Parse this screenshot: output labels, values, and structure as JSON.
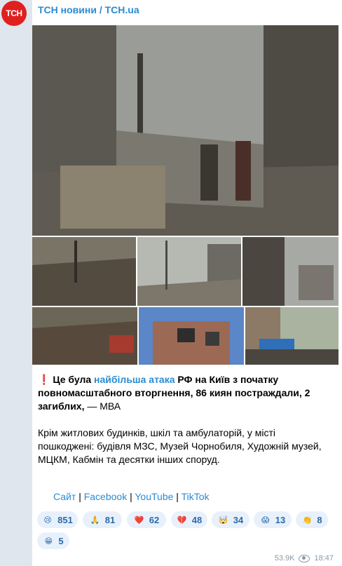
{
  "channel": {
    "avatar_text": "TCH",
    "title": "ТСН новини / TCH.ua"
  },
  "message": {
    "lead_excl": "❗",
    "lead_part1": "Це була ",
    "lead_link": "найбільша атака",
    "lead_part2": " РФ на Київ з початку повномасштабного вторгнення, 86 киян постраждали, 2 загиблих,",
    "lead_source": " — МВА",
    "paragraph2": "Крім житлових будинків, шкіл та амбулаторій, у місті пошкоджені: будівля МЗС, Музей Чорнобиля, Художній музей, МЦКМ, Кабмін та десятки інших споруд."
  },
  "links": {
    "site": "Сайт",
    "facebook": "Facebook",
    "youtube": "YouTube",
    "tiktok": "TikTok",
    "separator": "|"
  },
  "reactions": [
    {
      "emoji": "😢",
      "count": "851"
    },
    {
      "emoji": "🙏",
      "count": "81"
    },
    {
      "emoji": "❤️",
      "count": "62"
    },
    {
      "emoji": "💔",
      "count": "48"
    },
    {
      "emoji": "🤯",
      "count": "34"
    },
    {
      "emoji": "😱",
      "count": "13"
    },
    {
      "emoji": "👏",
      "count": "8"
    },
    {
      "emoji": "😁",
      "count": "5"
    }
  ],
  "footer": {
    "views": "53.9K",
    "time": "18:47"
  },
  "colors": {
    "accent": "#2b8bd1",
    "avatar_bg": "#e0201f",
    "reaction_bg": "#e8f1fb"
  }
}
